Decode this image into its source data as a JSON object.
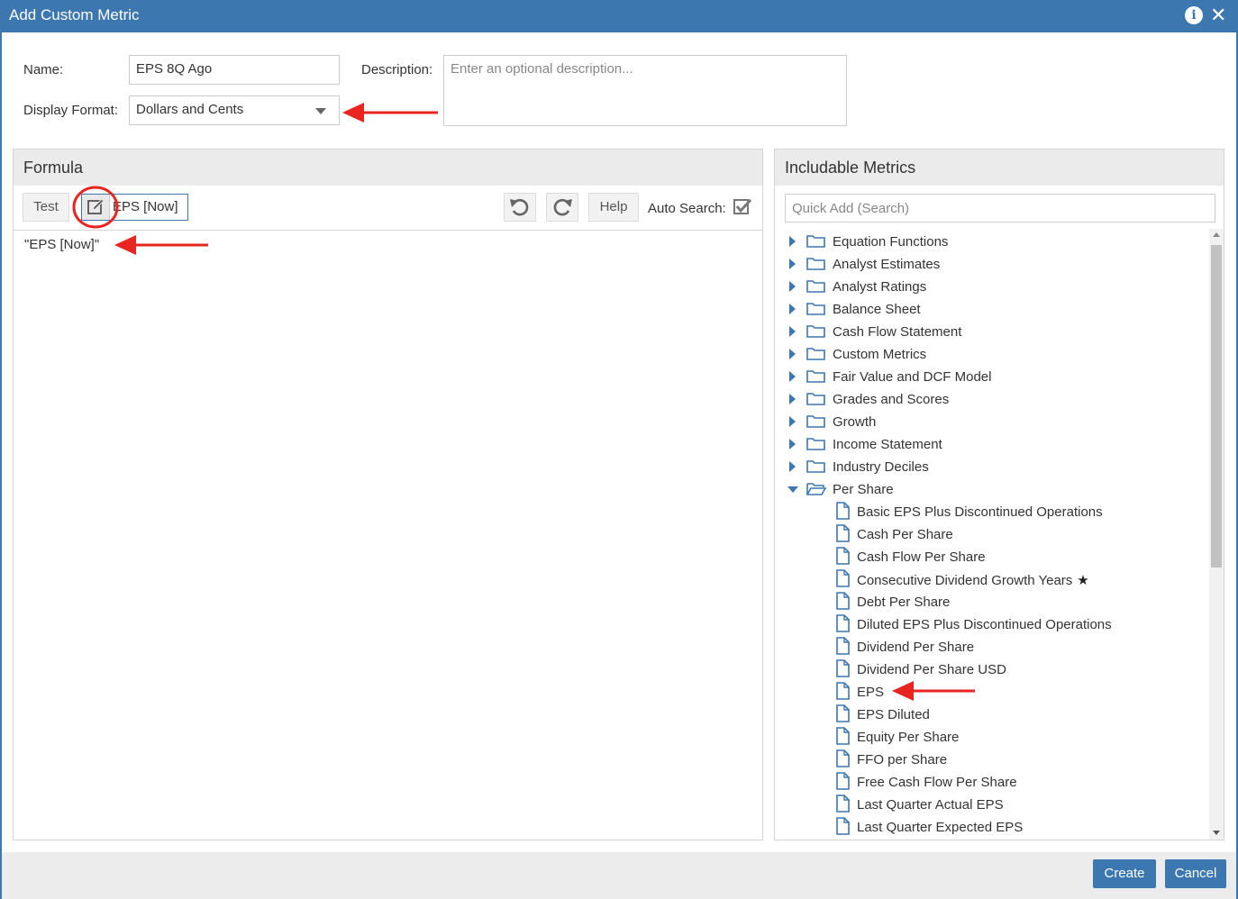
{
  "dialog": {
    "title": "Add Custom Metric"
  },
  "form": {
    "name_label": "Name:",
    "name_value": "EPS 8Q Ago",
    "description_label": "Description:",
    "description_placeholder": "Enter an optional description...",
    "display_format_label": "Display Format:",
    "display_format_value": "Dollars and Cents"
  },
  "formula": {
    "title": "Formula",
    "test_label": "Test",
    "chip_label": "EPS [Now]",
    "help_label": "Help",
    "auto_search_label": "Auto Search:",
    "auto_search_checked": true,
    "content": "\"EPS [Now]\""
  },
  "includable": {
    "title": "Includable Metrics",
    "search_placeholder": "Quick Add (Search)",
    "folders": [
      {
        "label": "Equation Functions",
        "open": false
      },
      {
        "label": "Analyst Estimates",
        "open": false
      },
      {
        "label": "Analyst Ratings",
        "open": false
      },
      {
        "label": "Balance Sheet",
        "open": false
      },
      {
        "label": "Cash Flow Statement",
        "open": false
      },
      {
        "label": "Custom Metrics",
        "open": false
      },
      {
        "label": "Fair Value and DCF Model",
        "open": false
      },
      {
        "label": "Grades and Scores",
        "open": false
      },
      {
        "label": "Growth",
        "open": false
      },
      {
        "label": "Income Statement",
        "open": false
      },
      {
        "label": "Industry Deciles",
        "open": false
      },
      {
        "label": "Per Share",
        "open": true
      }
    ],
    "per_share_items": [
      {
        "label": "Basic EPS Plus Discontinued Operations"
      },
      {
        "label": "Cash Per Share"
      },
      {
        "label": "Cash Flow Per Share"
      },
      {
        "label": "Consecutive Dividend Growth Years",
        "starred": true
      },
      {
        "label": "Debt Per Share"
      },
      {
        "label": "Diluted EPS Plus Discontinued Operations"
      },
      {
        "label": "Dividend Per Share"
      },
      {
        "label": "Dividend Per Share USD"
      },
      {
        "label": "EPS"
      },
      {
        "label": "EPS Diluted"
      },
      {
        "label": "Equity Per Share"
      },
      {
        "label": "FFO per Share"
      },
      {
        "label": "Free Cash Flow Per Share"
      },
      {
        "label": "Last Quarter Actual EPS"
      },
      {
        "label": "Last Quarter Expected EPS"
      }
    ]
  },
  "footer": {
    "create_label": "Create",
    "cancel_label": "Cancel"
  },
  "colors": {
    "accent": "#3d77b0",
    "annotation": "#e8251f"
  }
}
